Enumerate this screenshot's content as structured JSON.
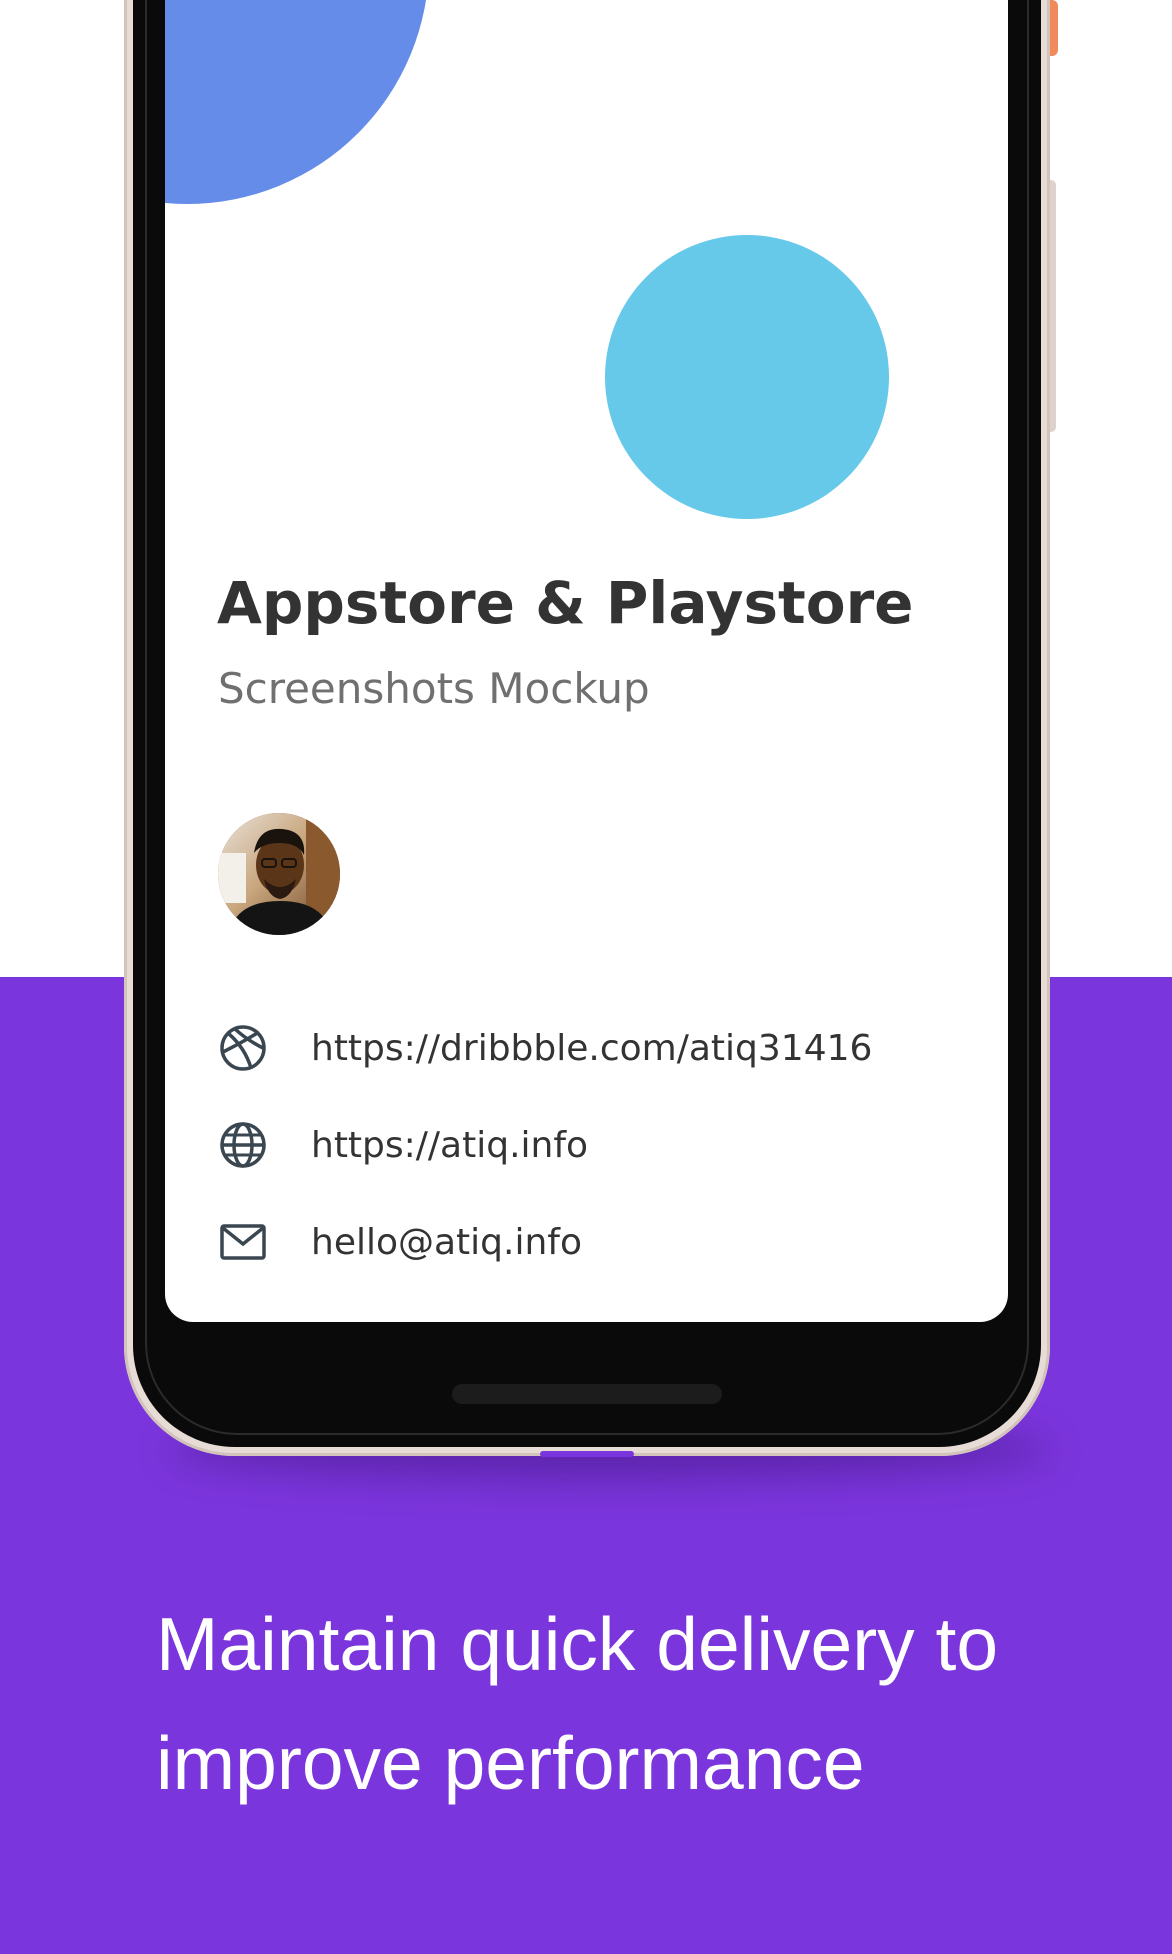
{
  "colors": {
    "background_top": "#ffffff",
    "background_bottom": "#7b35dc",
    "blob_blue": "#658ce9",
    "blob_cyan": "#67c9ea",
    "title_text": "#333333",
    "subtitle_text": "#707070",
    "caption_text": "#ffffff"
  },
  "screen": {
    "title": "Appstore & Playstore",
    "subtitle": "Screenshots Mockup",
    "contacts": [
      {
        "icon": "dribbble-icon",
        "text": "https://dribbble.com/atiq31416"
      },
      {
        "icon": "globe-icon",
        "text": "https://atiq.info"
      },
      {
        "icon": "mail-icon",
        "text": "hello@atiq.info"
      }
    ]
  },
  "caption": {
    "line1": "Maintain quick delivery to",
    "line2": "improve performance"
  }
}
